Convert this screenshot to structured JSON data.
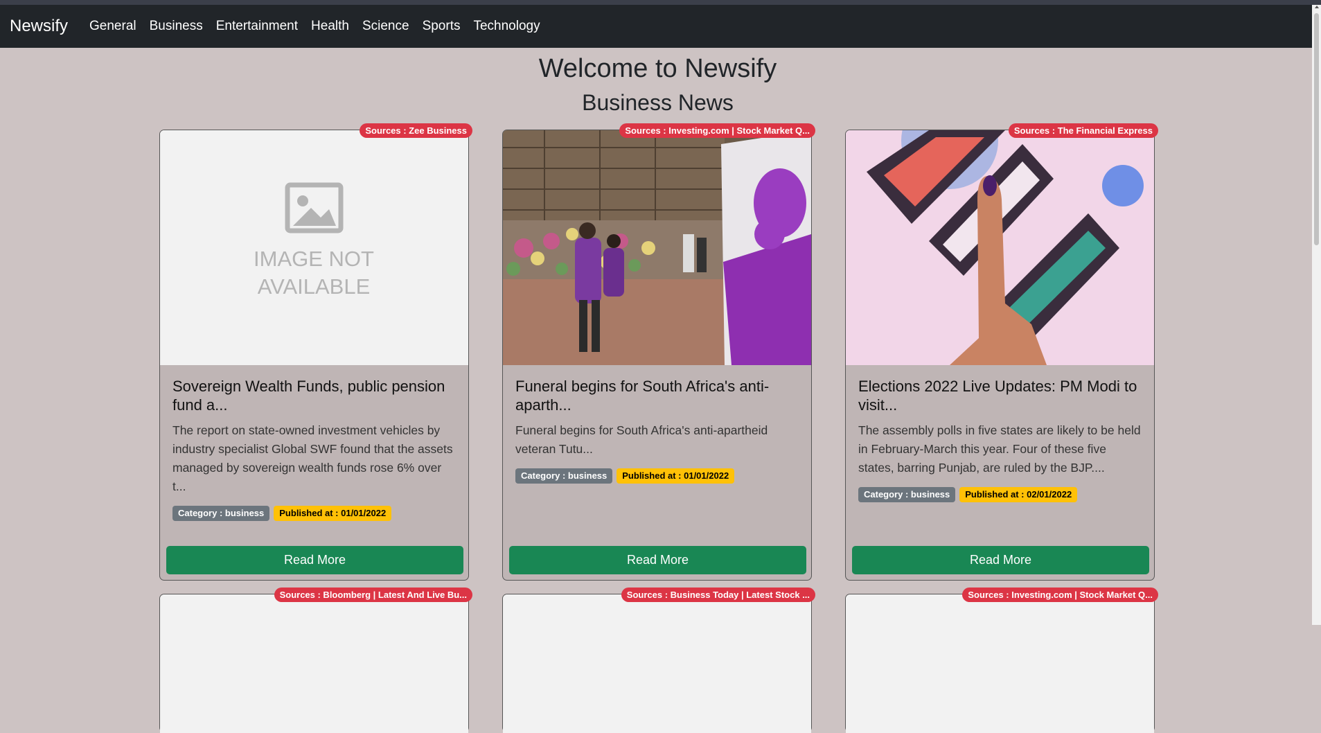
{
  "navbar": {
    "brand": "Newsify",
    "links": [
      "General",
      "Business",
      "Entertainment",
      "Health",
      "Science",
      "Sports",
      "Technology"
    ]
  },
  "heading": "Welcome to Newsify",
  "subheading": "Business News",
  "cards": [
    {
      "source": "Sources : Zee Business",
      "image": "image-not-available",
      "placeholder_text": [
        "IMAGE NOT",
        "AVAILABLE"
      ],
      "title": "Sovereign Wealth Funds, public pension fund a...",
      "text": "The report on state-owned investment vehicles by industry specialist Global SWF found that the assets managed by sovereign wealth funds rose 6% over t...",
      "category": "Category : business",
      "published": "Published at : 01/01/2022",
      "button": "Read More"
    },
    {
      "source": "Sources : Investing.com | Stock Market Q...",
      "image": "funeral-memorial-photo",
      "title": "Funeral begins for South Africa's anti-aparth...",
      "text": "Funeral begins for South Africa's anti-apartheid veteran Tutu...",
      "category": "Category : business",
      "published": "Published at : 01/01/2022",
      "button": "Read More"
    },
    {
      "source": "Sources : The Financial Express",
      "image": "election-finger-photo",
      "title": "Elections 2022 Live Updates: PM Modi to visit...",
      "text": "The assembly polls in five states are likely to be held in February-March this year. Four of these five states, barring Punjab, are ruled by the BJP....",
      "category": "Category : business",
      "published": "Published at : 02/01/2022",
      "button": "Read More"
    }
  ],
  "row2_sources": [
    "Sources : Bloomberg | Latest And Live Bu...",
    "Sources : Business Today | Latest Stock ...",
    "Sources : Investing.com | Stock Market Q..."
  ],
  "colors": {
    "navbar": "#212529",
    "page_bg": "#cdc3c3",
    "card_bg": "#bfb5b5",
    "source_badge": "#dc3545",
    "category_badge": "#6c757d",
    "date_badge": "#ffc107",
    "button": "#198754"
  }
}
